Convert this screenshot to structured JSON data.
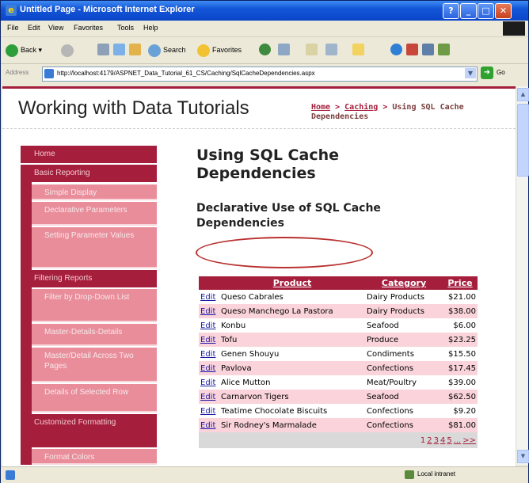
{
  "window": {
    "title": "Untitled Page - Microsoft Internet Explorer",
    "buttons": {
      "help": "?",
      "minimize": "_",
      "maximize": "□",
      "close": "✕"
    }
  },
  "menu": [
    "File",
    "Edit",
    "View",
    "Favorites",
    "Tools",
    "Help"
  ],
  "toolbar": {
    "back": "Back",
    "search": "Search",
    "favorites": "Favorites"
  },
  "address": {
    "label": "Address",
    "url": "http://localhost:4179/ASPNET_Data_Tutorial_61_CS/Caching/SqlCacheDependencies.aspx",
    "go": "Go"
  },
  "status": {
    "zone": "Local intranet"
  },
  "page": {
    "site_title": "Working with Data Tutorials",
    "breadcrumb": {
      "home": "Home",
      "sep": " > ",
      "section": "Caching",
      "current": "Using SQL Cache Dependencies"
    },
    "title": "Using SQL Cache Dependencies",
    "subtitle": "Declarative Use of SQL Cache Dependencies"
  },
  "nav": {
    "items": [
      {
        "label": "Home",
        "type": "head"
      },
      {
        "label": "Basic Reporting",
        "type": "head"
      },
      {
        "label": "Simple Display",
        "type": "item"
      },
      {
        "label": "Declarative Parameters",
        "type": "item"
      },
      {
        "label": "Setting Parameter Values",
        "type": "item"
      },
      {
        "label": "Filtering Reports",
        "type": "head"
      },
      {
        "label": "Filter by Drop-Down List",
        "type": "item"
      },
      {
        "label": "Master-Details-Details",
        "type": "item"
      },
      {
        "label": "Master/Detail Across Two Pages",
        "type": "item"
      },
      {
        "label": "Details of Selected Row",
        "type": "item"
      },
      {
        "label": "Customized Formatting",
        "type": "head"
      },
      {
        "label": "Format Colors",
        "type": "item"
      }
    ]
  },
  "grid": {
    "headers": [
      "Product",
      "Category",
      "Price"
    ],
    "edit_label": "Edit",
    "rows": [
      [
        "Queso Cabrales",
        "Dairy Products",
        "$21.00"
      ],
      [
        "Queso Manchego La Pastora",
        "Dairy Products",
        "$38.00"
      ],
      [
        "Konbu",
        "Seafood",
        "$6.00"
      ],
      [
        "Tofu",
        "Produce",
        "$23.25"
      ],
      [
        "Genen Shouyu",
        "Condiments",
        "$15.50"
      ],
      [
        "Pavlova",
        "Confections",
        "$17.45"
      ],
      [
        "Alice Mutton",
        "Meat/Poultry",
        "$39.00"
      ],
      [
        "Carnarvon Tigers",
        "Seafood",
        "$62.50"
      ],
      [
        "Teatime Chocolate Biscuits",
        "Confections",
        "$9.20"
      ],
      [
        "Sir Rodney's Marmalade",
        "Confections",
        "$81.00"
      ]
    ],
    "pager": [
      "1",
      "2",
      "3",
      "4",
      "5",
      "...",
      ">>"
    ]
  },
  "colors": {
    "accent": "#a51e3c",
    "nav_item": "#e98d9b",
    "row_alt": "#fad4da"
  }
}
